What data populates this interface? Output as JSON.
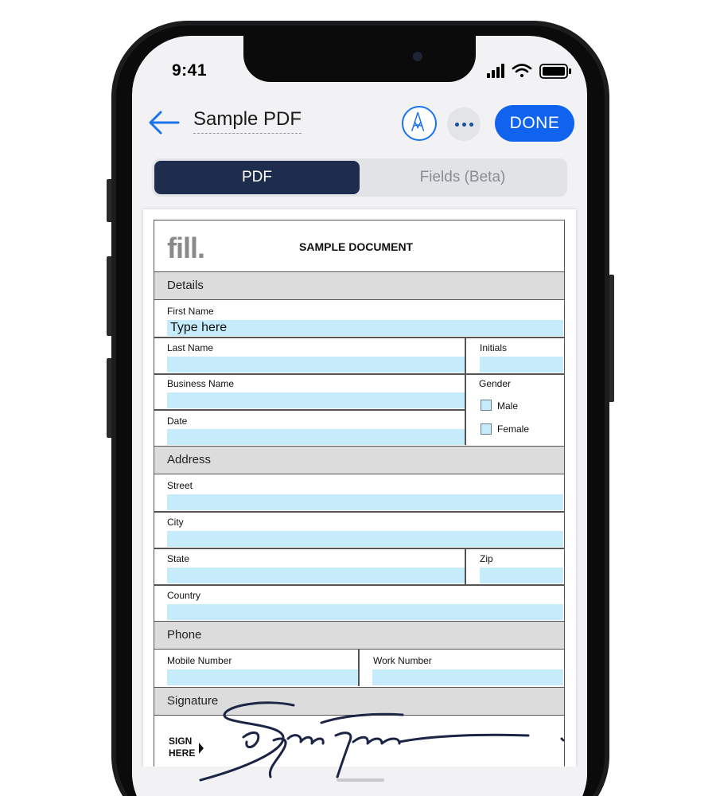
{
  "status_bar": {
    "time": "9:41"
  },
  "header": {
    "title": "Sample PDF",
    "done_label": "DONE"
  },
  "tabs": [
    {
      "label": "PDF",
      "active": true
    },
    {
      "label": "Fields (Beta)",
      "active": false
    }
  ],
  "document": {
    "logo": "fill.",
    "title": "SAMPLE DOCUMENT",
    "sections": {
      "details": "Details",
      "address": "Address",
      "phone": "Phone",
      "signature": "Signature"
    },
    "fields": {
      "first_name": {
        "label": "First Name",
        "value": "Type here"
      },
      "last_name": {
        "label": "Last Name"
      },
      "initials": {
        "label": "Initials"
      },
      "business_name": {
        "label": "Business Name"
      },
      "gender": {
        "label": "Gender",
        "options": [
          "Male",
          "Female"
        ]
      },
      "date": {
        "label": "Date"
      },
      "street": {
        "label": "Street"
      },
      "city": {
        "label": "City"
      },
      "state": {
        "label": "State"
      },
      "zip": {
        "label": "Zip"
      },
      "country": {
        "label": "Country"
      },
      "mobile": {
        "label": "Mobile Number"
      },
      "work": {
        "label": "Work Number"
      }
    },
    "sign_here": [
      "SIGN",
      "HERE"
    ]
  },
  "colors": {
    "accent": "#0f63ef",
    "tab_active": "#1e2d4e",
    "field_fill": "#c6ecfb",
    "section_bg": "#dcdcdc",
    "signature_ink": "#1c2545"
  }
}
